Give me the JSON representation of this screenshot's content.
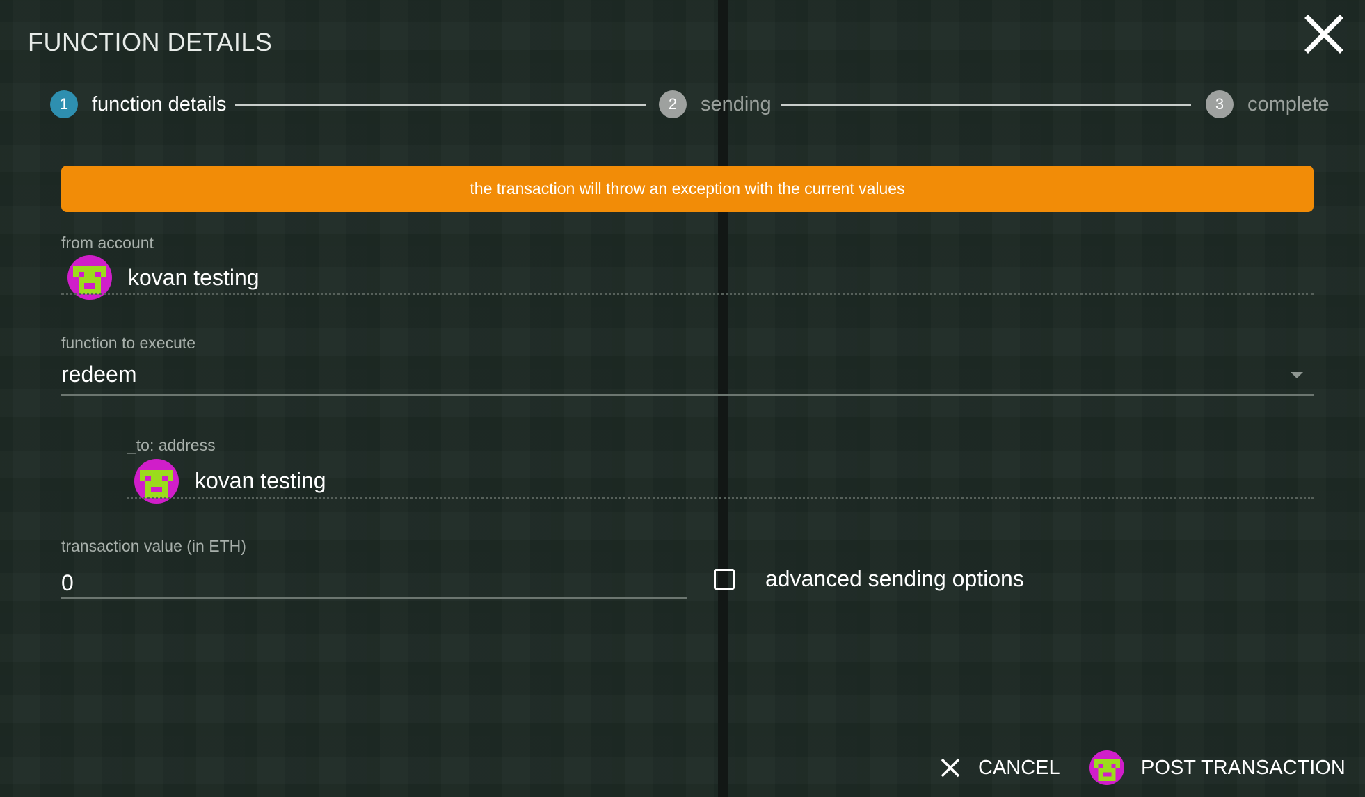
{
  "dialog": {
    "title": "FUNCTION DETAILS",
    "close_icon": "close-icon"
  },
  "stepper": {
    "steps": [
      {
        "number": "1",
        "label": "function details",
        "state": "active"
      },
      {
        "number": "2",
        "label": "sending",
        "state": "inactive"
      },
      {
        "number": "3",
        "label": "complete",
        "state": "inactive"
      }
    ]
  },
  "warning": {
    "text": "the transaction will throw an exception with the current values",
    "color": "#f28c07"
  },
  "from_account": {
    "label": "from account",
    "name": "kovan testing",
    "avatar_icon": "identicon"
  },
  "function_select": {
    "label": "function to execute",
    "value": "redeem"
  },
  "param_to": {
    "label": "_to: address",
    "name": "kovan testing",
    "avatar_icon": "identicon"
  },
  "transaction_value": {
    "label": "transaction value (in ETH)",
    "value": "0"
  },
  "advanced": {
    "label": "advanced sending options",
    "checked": false
  },
  "actions": {
    "cancel_label": "CANCEL",
    "post_label": "POST TRANSACTION"
  },
  "colors": {
    "accent_step": "#2e8fb0",
    "identicon_magenta": "#d01ec9",
    "identicon_green": "#9bdc1d"
  }
}
